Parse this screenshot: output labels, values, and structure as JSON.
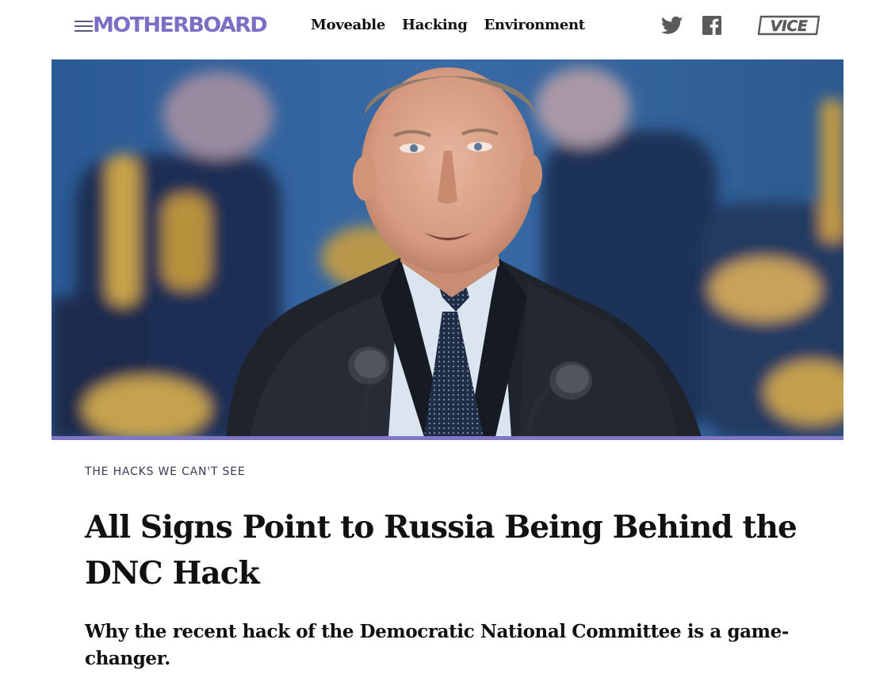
{
  "header": {
    "logo_text": "MOTHERBOARD",
    "nav": [
      {
        "label": "Moveable"
      },
      {
        "label": "Hacking"
      },
      {
        "label": "Environment"
      }
    ],
    "icons": {
      "menu": "menu-icon",
      "twitter": "twitter-icon",
      "facebook": "facebook-icon",
      "vice": "vice-logo"
    },
    "vice_logo_text": "VICE"
  },
  "hero": {
    "image": "speaker-at-podium-photo",
    "accent_rule_color": "#7f76c6"
  },
  "article": {
    "kicker": "THE HACKS WE CAN'T SEE",
    "headline": "All Signs Point to Russia Being Behind the DNC Hack",
    "dek": "Why the recent hack of the Democratic National Committee is a game-changer."
  },
  "colors": {
    "brand": "#7a6fc4",
    "text": "#111111",
    "icon": "#5a5a5a"
  }
}
